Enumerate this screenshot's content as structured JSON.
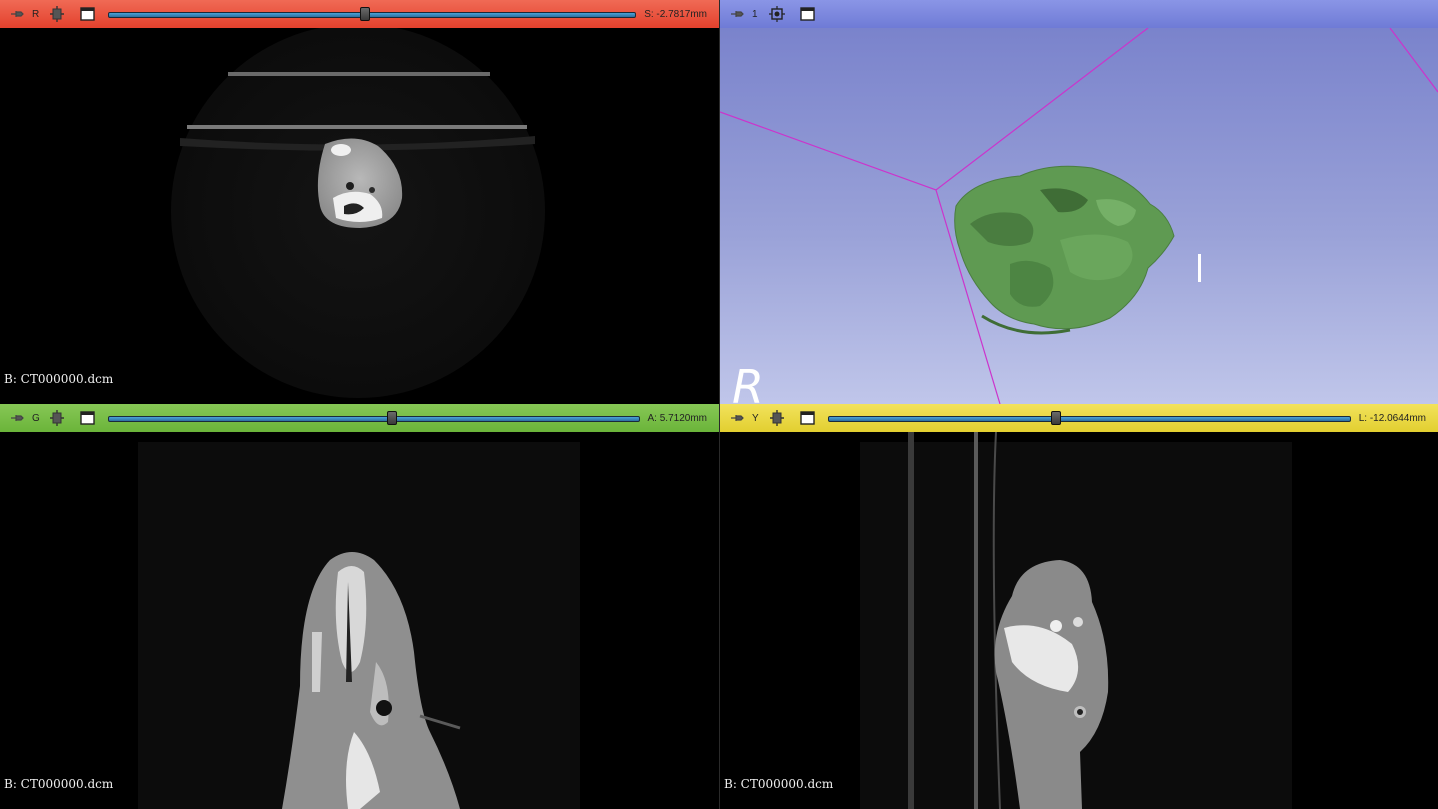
{
  "views": {
    "red": {
      "color_name": "red",
      "bar_color": "#e3412d",
      "letter": "R",
      "offset": "S: -2.7817mm",
      "slider_fraction": 0.485,
      "corner_text": "B: CT000000.dcm",
      "icons": [
        "pin-icon",
        "slice-control-icon",
        "maximize-view-icon"
      ]
    },
    "blue": {
      "color_name": "blue",
      "bar_color": "#6f7bd6",
      "letter": "1",
      "orientation_marker": "R",
      "orientation_marker_2": "I",
      "icons": [
        "pin-icon",
        "center-view-icon",
        "maximize-view-icon"
      ]
    },
    "green": {
      "color_name": "green",
      "bar_color": "#6bb43a",
      "letter": "G",
      "offset": "A: 5.7120mm",
      "slider_fraction": 0.532,
      "corner_text": "B: CT000000.dcm",
      "icons": [
        "pin-icon",
        "slice-control-icon",
        "maximize-view-icon"
      ]
    },
    "yellow": {
      "color_name": "yellow",
      "bar_color": "#e2cf30",
      "letter": "Y",
      "offset": "L: -12.0644mm",
      "slider_fraction": 0.434,
      "corner_text": "B: CT000000.dcm",
      "icons": [
        "pin-icon",
        "slice-control-icon",
        "maximize-view-icon"
      ]
    }
  }
}
